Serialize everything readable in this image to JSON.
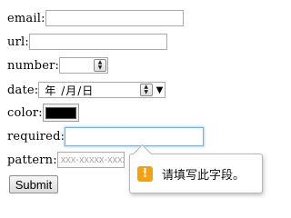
{
  "form": {
    "email": {
      "label": "email:",
      "value": ""
    },
    "url": {
      "label": "url:",
      "value": ""
    },
    "number": {
      "label": "number:",
      "value": ""
    },
    "date": {
      "label": "date:",
      "value": "年 /月/日"
    },
    "color": {
      "label": "color:",
      "value": "#000000"
    },
    "required": {
      "label": "required:",
      "value": ""
    },
    "pattern": {
      "label": "pattern:",
      "placeholder": "xxx-xxxxx-xxxx"
    },
    "submit_label": "Submit"
  },
  "validation_tooltip": {
    "icon": "warning-icon",
    "icon_glyph": "!",
    "message": "请填写此字段。",
    "accent": "#f4a20b"
  }
}
